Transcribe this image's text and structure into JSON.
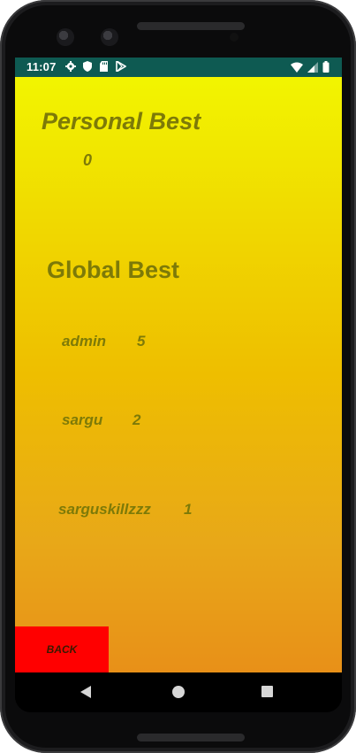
{
  "status_bar": {
    "time": "11:07",
    "left_icons": [
      "settings-icon",
      "shield-icon",
      "sd-card-icon",
      "play-store-icon"
    ],
    "right_icons": [
      "wifi-icon",
      "signal-icon",
      "battery-icon"
    ],
    "background": "#0e5a52"
  },
  "personal": {
    "title": "Personal Best",
    "score": "0"
  },
  "global": {
    "title": "Global Best",
    "entries": [
      {
        "name": "admin",
        "score": "5"
      },
      {
        "name": "sargu",
        "score": "2"
      },
      {
        "name": "sarguskillzzz",
        "score": "1"
      }
    ]
  },
  "back_button": {
    "label": "BACK",
    "color": "#ff0000"
  },
  "theme": {
    "gradient_top": "#f2f500",
    "gradient_bottom": "#e89018",
    "text_color": "#7d7a08"
  },
  "nav_bar": {
    "buttons": [
      "back-icon",
      "home-icon",
      "recents-icon"
    ]
  }
}
